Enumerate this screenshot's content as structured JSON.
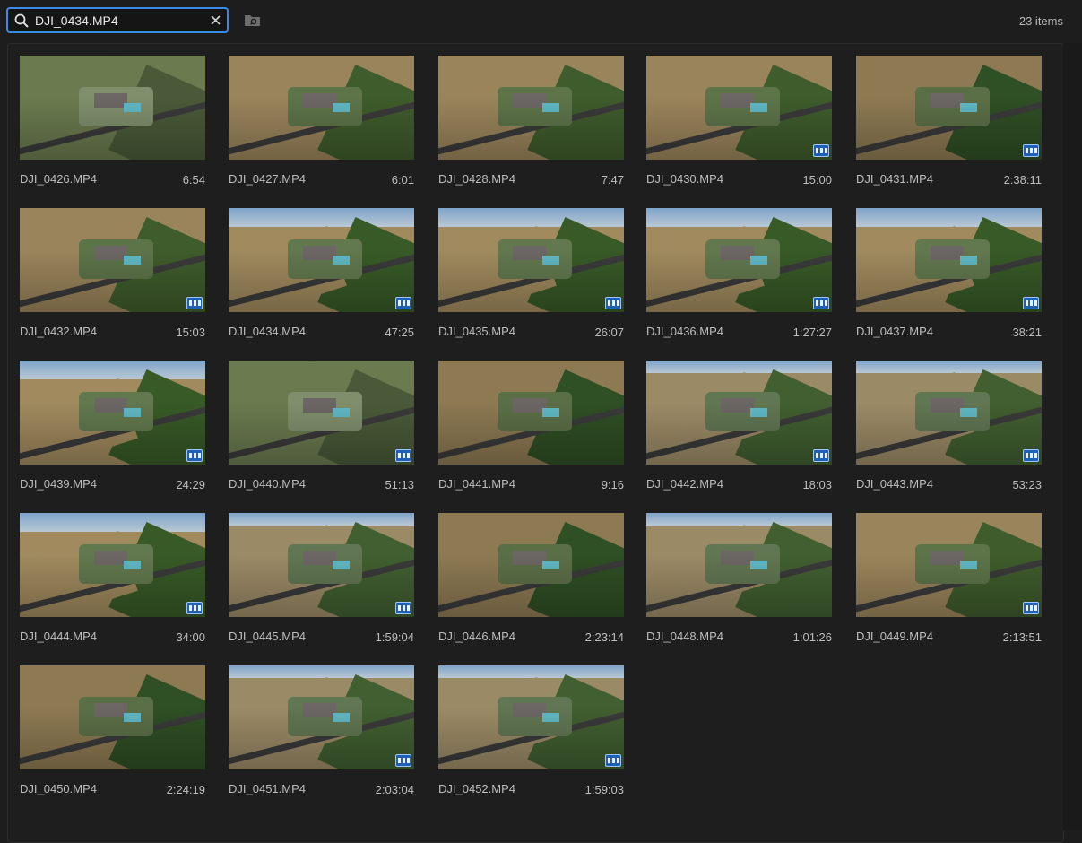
{
  "search": {
    "value": "DJI_0434.MP4",
    "placeholder": "Search"
  },
  "item_count": "23 items",
  "icons": {
    "search": "search-icon",
    "clear": "close-icon",
    "folder": "folder-search-icon",
    "badge": "video-clip-icon"
  },
  "colors": {
    "accent": "#3b8be6",
    "badge": "#1f5fb5",
    "background": "#1d1d1d"
  },
  "items": [
    {
      "name": "DJI_0426.MP4",
      "duration": "6:54",
      "badge": false,
      "variant": "top"
    },
    {
      "name": "DJI_0427.MP4",
      "duration": "6:01",
      "badge": false,
      "variant": "oblique"
    },
    {
      "name": "DJI_0428.MP4",
      "duration": "7:47",
      "badge": false,
      "variant": "oblique"
    },
    {
      "name": "DJI_0430.MP4",
      "duration": "15:00",
      "badge": true,
      "variant": "oblique"
    },
    {
      "name": "DJI_0431.MP4",
      "duration": "2:38:11",
      "badge": true,
      "variant": "field"
    },
    {
      "name": "DJI_0432.MP4",
      "duration": "15:03",
      "badge": true,
      "variant": "oblique"
    },
    {
      "name": "DJI_0434.MP4",
      "duration": "47:25",
      "badge": true,
      "variant": "sky"
    },
    {
      "name": "DJI_0435.MP4",
      "duration": "26:07",
      "badge": true,
      "variant": "sky"
    },
    {
      "name": "DJI_0436.MP4",
      "duration": "1:27:27",
      "badge": true,
      "variant": "sky"
    },
    {
      "name": "DJI_0437.MP4",
      "duration": "38:21",
      "badge": true,
      "variant": "sky"
    },
    {
      "name": "DJI_0439.MP4",
      "duration": "24:29",
      "badge": true,
      "variant": "sky"
    },
    {
      "name": "DJI_0440.MP4",
      "duration": "51:13",
      "badge": true,
      "variant": "top"
    },
    {
      "name": "DJI_0441.MP4",
      "duration": "9:16",
      "badge": false,
      "variant": "field"
    },
    {
      "name": "DJI_0442.MP4",
      "duration": "18:03",
      "badge": true,
      "variant": "haze"
    },
    {
      "name": "DJI_0443.MP4",
      "duration": "53:23",
      "badge": true,
      "variant": "haze"
    },
    {
      "name": "DJI_0444.MP4",
      "duration": "34:00",
      "badge": true,
      "variant": "sky"
    },
    {
      "name": "DJI_0445.MP4",
      "duration": "1:59:04",
      "badge": true,
      "variant": "haze"
    },
    {
      "name": "DJI_0446.MP4",
      "duration": "2:23:14",
      "badge": false,
      "variant": "field"
    },
    {
      "name": "DJI_0448.MP4",
      "duration": "1:01:26",
      "badge": false,
      "variant": "haze"
    },
    {
      "name": "DJI_0449.MP4",
      "duration": "2:13:51",
      "badge": true,
      "variant": "oblique"
    },
    {
      "name": "DJI_0450.MP4",
      "duration": "2:24:19",
      "badge": false,
      "variant": "field"
    },
    {
      "name": "DJI_0451.MP4",
      "duration": "2:03:04",
      "badge": true,
      "variant": "haze"
    },
    {
      "name": "DJI_0452.MP4",
      "duration": "1:59:03",
      "badge": true,
      "variant": "haze"
    }
  ]
}
